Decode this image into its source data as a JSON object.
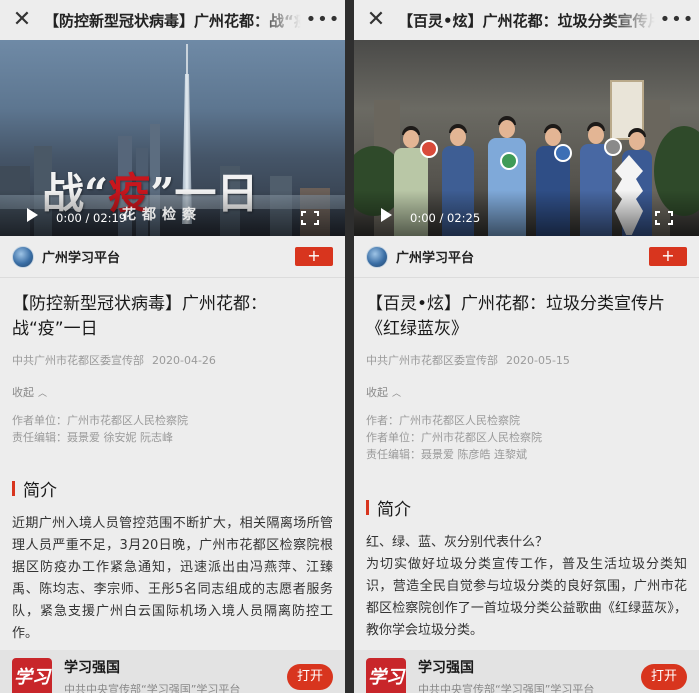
{
  "panels": [
    {
      "topbar": {
        "close_icon": "close-icon",
        "title": "【防控新型冠状病毒】广州花都：战“疫”一日",
        "more_icon": "more-icon"
      },
      "video": {
        "title_part1": "战“",
        "title_red": "疫",
        "title_part2": "”一日",
        "subtitle": "花都检察",
        "time": "0:00 / 02:19"
      },
      "source": {
        "name": "广州学习平台",
        "add_label": "+"
      },
      "article": {
        "title": "【防控新型冠状病毒】广州花都：战“疫”一日",
        "publisher": "中共广州市花都区委宣传部",
        "date": "2020-04-26",
        "collapse_label": "收起",
        "credits": [
          "作者单位：广州市花都区人民检察院",
          "责任编辑：聂景爱 徐安妮 阮志峰"
        ],
        "section_title": "简介",
        "body": "近期广州入境人员管控范围不断扩大，相关隔离场所管理人员严重不足，3月20日晚，广州市花都区检察院根据区防疫办工作紧急通知，迅速派出由冯燕萍、江臻禹、陈均志、李宗师、王彤5名同志组成的志愿者服务队，紧急支援广州白云国际机场入境人员隔离防控工作。"
      },
      "promo": {
        "logo_text": "学习",
        "name": "学习强国",
        "desc": "中共中央宣传部“学习强国”学习平台",
        "open_label": "打开"
      }
    },
    {
      "topbar": {
        "close_icon": "close-icon",
        "title": "【百灵•炫】广州花都：垃圾分类宣传片《红绿蓝灰》",
        "more_icon": "more-icon"
      },
      "video": {
        "time": "0:00 / 02:25"
      },
      "source": {
        "name": "广州学习平台",
        "add_label": "+"
      },
      "article": {
        "title": "【百灵•炫】广州花都：垃圾分类宣传片《红绿蓝灰》",
        "publisher": "中共广州市花都区委宣传部",
        "date": "2020-05-15",
        "collapse_label": "收起",
        "credits": [
          "作者：广州市花都区人民检察院",
          "作者单位：广州市花都区人民检察院",
          "责任编辑：聂景爱 陈彦皓 连黎斌"
        ],
        "section_title": "简介",
        "body": "红、绿、蓝、灰分别代表什么？\n为切实做好垃圾分类宣传工作，普及生活垃圾分类知识，营造全民自觉参与垃圾分类的良好氛围，广州市花都区检察院创作了一首垃圾分类公益歌曲《红绿蓝灰》，教你学会垃圾分类。"
      },
      "promo": {
        "logo_text": "学习",
        "name": "学习强国",
        "desc": "中共中央宣传部“学习强国”学习平台",
        "open_label": "打开"
      }
    }
  ],
  "colors": {
    "accent": "#d8351e",
    "background": "#ededed",
    "divider": "#2e2e2e"
  }
}
